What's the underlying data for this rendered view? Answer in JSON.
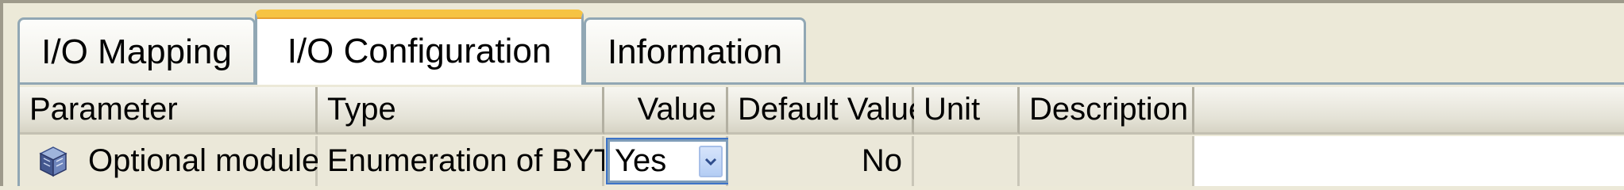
{
  "tabs": [
    {
      "label": "I/O Mapping",
      "active": false
    },
    {
      "label": "I/O Configuration",
      "active": true
    },
    {
      "label": "Information",
      "active": false
    }
  ],
  "table": {
    "columns": [
      "Parameter",
      "Type",
      "Value",
      "Default Value",
      "Unit",
      "Description"
    ],
    "rows": [
      {
        "parameter": "Optional module",
        "type": "Enumeration of BYTE",
        "value": "Yes",
        "default_value": "No",
        "unit": "",
        "description": ""
      }
    ]
  },
  "icons": {
    "module": "cube-module-icon",
    "dropdown": "chevron-down-icon"
  },
  "colors": {
    "active_tab_accent": "#f6c343",
    "tab_border": "#91a7b4",
    "background": "#ece9d8"
  }
}
